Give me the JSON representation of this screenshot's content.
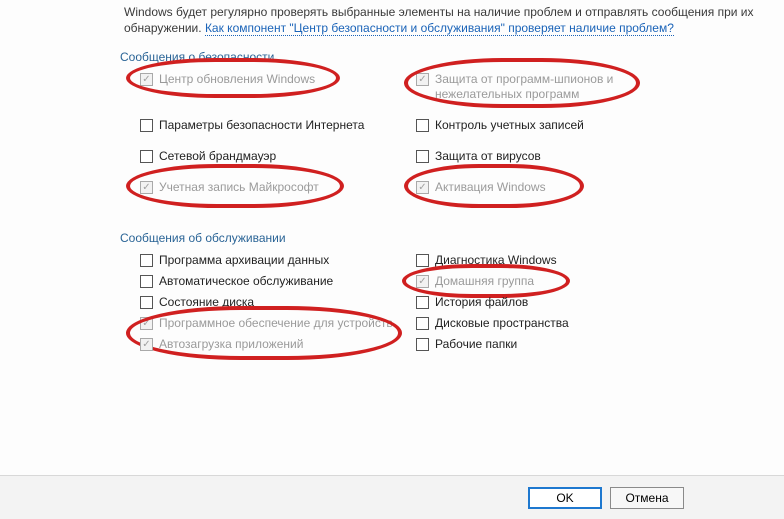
{
  "intro": {
    "text_before": "Windows будет регулярно проверять выбранные элементы на наличие проблем и отправлять сообщения при их обнаружении. ",
    "link": "Как компонент \"Центр безопасности и обслуживания\" проверяет наличие проблем?"
  },
  "sections": {
    "security": {
      "title": "Сообщения о безопасности",
      "items": {
        "windows_update": "Центр обновления Windows",
        "spyware": "Защита от программ-шпионов и нежелательных программ",
        "internet_security": "Параметры безопасности Интернета",
        "uac": "Контроль учетных записей",
        "firewall": "Сетевой брандмауэр",
        "virus": "Защита от вирусов",
        "ms_account": "Учетная запись Майкрософт",
        "activation": "Активация Windows"
      }
    },
    "maintenance": {
      "title": "Сообщения об обслуживании",
      "items": {
        "backup": "Программа архивации данных",
        "diagnostics": "Диагностика Windows",
        "auto_maint": "Автоматическое обслуживание",
        "homegroup": "Домашняя группа",
        "disk_state": "Состояние диска",
        "file_history": "История файлов",
        "device_software": "Программное обеспечение для устройств",
        "storage_spaces": "Дисковые пространства",
        "app_startup": "Автозагрузка приложений",
        "work_folders": "Рабочие папки"
      }
    }
  },
  "buttons": {
    "ok": "OK",
    "cancel": "Отмена"
  },
  "annotation_color": "#d02020"
}
